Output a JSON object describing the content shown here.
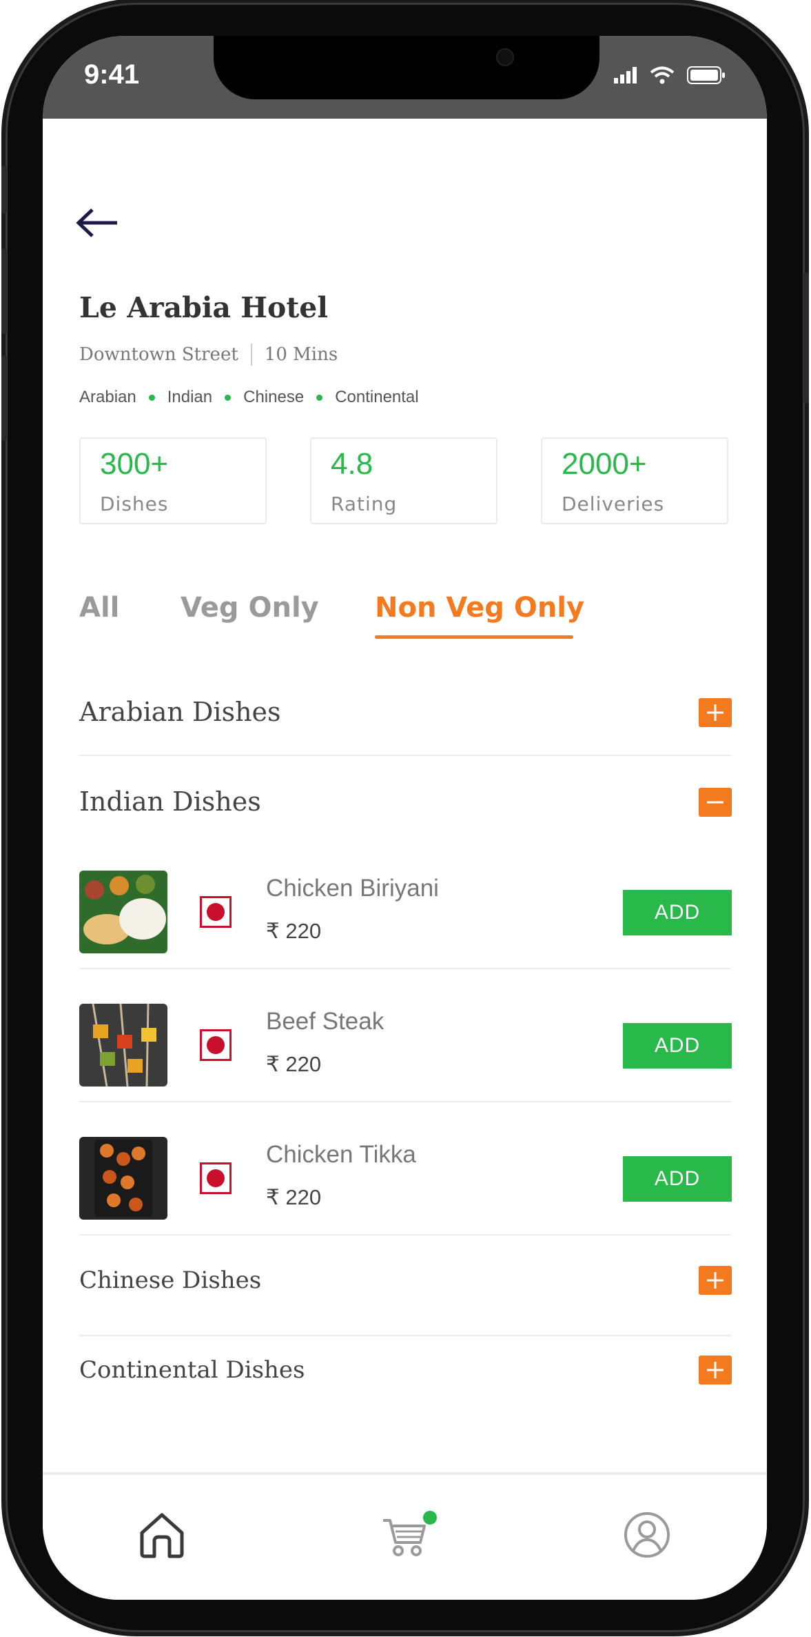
{
  "status_bar": {
    "time": "9:41"
  },
  "restaurant": {
    "name": "Le Arabia Hotel",
    "location": "Downtown Street",
    "eta": "10 Mins",
    "cuisines": [
      "Arabian",
      "Indian",
      "Chinese",
      "Continental"
    ]
  },
  "stats": [
    {
      "value": "300+",
      "label": "Dishes"
    },
    {
      "value": "4.8",
      "label": "Rating"
    },
    {
      "value": "2000+",
      "label": "Deliveries"
    }
  ],
  "filters": {
    "tabs": [
      "All",
      "Veg Only",
      "Non Veg Only"
    ],
    "active": "Non Veg Only"
  },
  "sections": {
    "arabian": {
      "title": "Arabian Dishes",
      "expanded": false
    },
    "indian": {
      "title": "Indian Dishes",
      "expanded": true
    },
    "chinese": {
      "title": "Chinese Dishes",
      "expanded": false
    },
    "continental": {
      "title": "Continental Dishes",
      "expanded": false
    }
  },
  "dishes": [
    {
      "name": "Chicken Biriyani",
      "price": "₹ 220",
      "add_label": "ADD"
    },
    {
      "name": "Beef Steak",
      "price": "₹ 220",
      "add_label": "ADD"
    },
    {
      "name": "Chicken Tikka",
      "price": "₹ 220",
      "add_label": "ADD"
    }
  ],
  "colors": {
    "accent": "#f37a1f",
    "green": "#29b84a",
    "nonveg": "#c8102e"
  },
  "nav": {
    "items": [
      "home-icon",
      "cart-icon",
      "profile-icon"
    ]
  }
}
